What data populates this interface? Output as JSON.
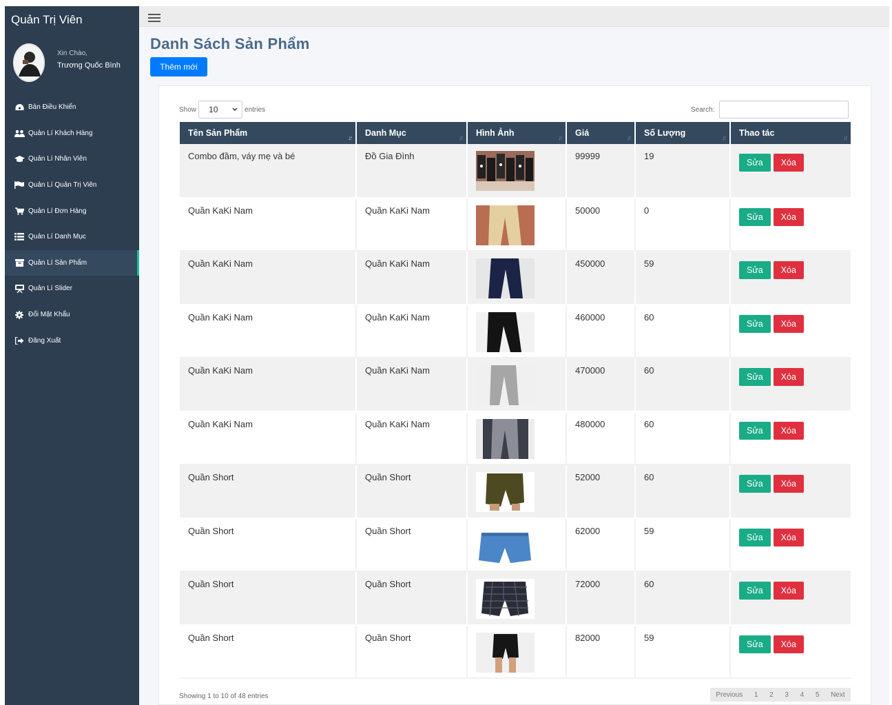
{
  "sidebar": {
    "brand": "Quản Trị Viên",
    "greeting": "Xin Chào,",
    "user_name": "Trương Quốc Bình",
    "items": [
      {
        "label": "Bản Điều Khiển",
        "icon": "dashboard-icon"
      },
      {
        "label": "Quản Lí Khách Hàng",
        "icon": "users-icon"
      },
      {
        "label": "Quản Lí Nhân Viên",
        "icon": "graduation-cap-icon"
      },
      {
        "label": "Quản Lí Quản Trị Viên",
        "icon": "flag-icon"
      },
      {
        "label": "Quản Lí Đơn Hàng",
        "icon": "cart-icon"
      },
      {
        "label": "Quản Lí Danh Mục",
        "icon": "list-icon"
      },
      {
        "label": "Quản Lí Sản Phẩm",
        "icon": "archive-icon",
        "active": true
      },
      {
        "label": "Quản Lí Slider",
        "icon": "presentation-icon"
      },
      {
        "label": "Đổi Mật Khẩu",
        "icon": "gear-icon"
      },
      {
        "label": "Đăng Xuất",
        "icon": "sign-out-icon"
      }
    ]
  },
  "page": {
    "title": "Danh Sách Sản Phẩm",
    "add_button": "Thêm mới"
  },
  "table_controls": {
    "show_label": "Show",
    "entries_value": "10",
    "entries_label": "entries",
    "search_label": "Search:",
    "search_value": ""
  },
  "columns": [
    "Tên Sản Phẩm",
    "Danh Mục",
    "Hình Ảnh",
    "Giá",
    "Số Lượng",
    "Thao tác"
  ],
  "rows": [
    {
      "name": "Combo đầm, váy mẹ và bé",
      "category": "Đồ Gia Đình",
      "image": "family-outfit",
      "price": "99999",
      "qty": "19"
    },
    {
      "name": "Quần KaKi Nam",
      "category": "Quần KaKi Nam",
      "image": "khaki-beige",
      "price": "50000",
      "qty": "0"
    },
    {
      "name": "Quần KaKi Nam",
      "category": "Quần KaKi Nam",
      "image": "khaki-navy",
      "price": "450000",
      "qty": "59"
    },
    {
      "name": "Quần KaKi Nam",
      "category": "Quần KaKi Nam",
      "image": "khaki-black",
      "price": "460000",
      "qty": "60"
    },
    {
      "name": "Quần KaKi Nam",
      "category": "Quần KaKi Nam",
      "image": "khaki-lightgray",
      "price": "470000",
      "qty": "60"
    },
    {
      "name": "Quần KaKi Nam",
      "category": "Quần KaKi Nam",
      "image": "khaki-gray",
      "price": "480000",
      "qty": "60"
    },
    {
      "name": "Quần Short",
      "category": "Quần Short",
      "image": "short-olive",
      "price": "52000",
      "qty": "60"
    },
    {
      "name": "Quần Short",
      "category": "Quần Short",
      "image": "short-denim",
      "price": "62000",
      "qty": "59"
    },
    {
      "name": "Quần Short",
      "category": "Quần Short",
      "image": "short-plaid",
      "price": "72000",
      "qty": "60"
    },
    {
      "name": "Quần Short",
      "category": "Quần Short",
      "image": "short-black",
      "price": "82000",
      "qty": "59"
    }
  ],
  "actions": {
    "edit": "Sửa",
    "delete": "Xóa"
  },
  "footer": {
    "info": "Showing 1 to 10 of 48 entries",
    "previous": "Previous",
    "pages": [
      "1",
      "2",
      "3",
      "4",
      "5"
    ],
    "next": "Next"
  },
  "colors": {
    "sidebar": "#2c3e50",
    "header": "#34495e",
    "primary": "#007bff",
    "edit": "#1aac86",
    "delete": "#e0303f"
  }
}
